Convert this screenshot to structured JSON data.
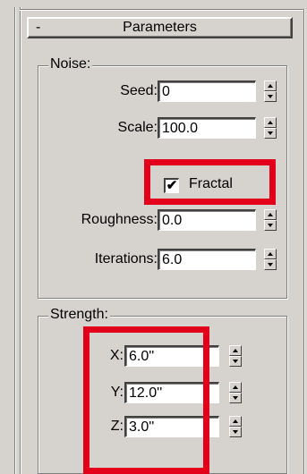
{
  "rollout": {
    "toggle": "-",
    "title": "Parameters"
  },
  "noise": {
    "legend": "Noise:",
    "seed": {
      "label": "Seed:",
      "value": "0"
    },
    "scale": {
      "label": "Scale:",
      "value": "100.0"
    },
    "fractal": {
      "label": "Fractal",
      "checked": true,
      "mark": "✔"
    },
    "roughness": {
      "label": "Roughness:",
      "value": "0.0"
    },
    "iterations": {
      "label": "Iterations:",
      "value": "6.0"
    }
  },
  "strength": {
    "legend": "Strength:",
    "x": {
      "label": "X:",
      "value": "6.0''"
    },
    "y": {
      "label": "Y:",
      "value": "12.0''"
    },
    "z": {
      "label": "Z:",
      "value": "3.0''"
    }
  },
  "annotation_color": "#e3001b"
}
